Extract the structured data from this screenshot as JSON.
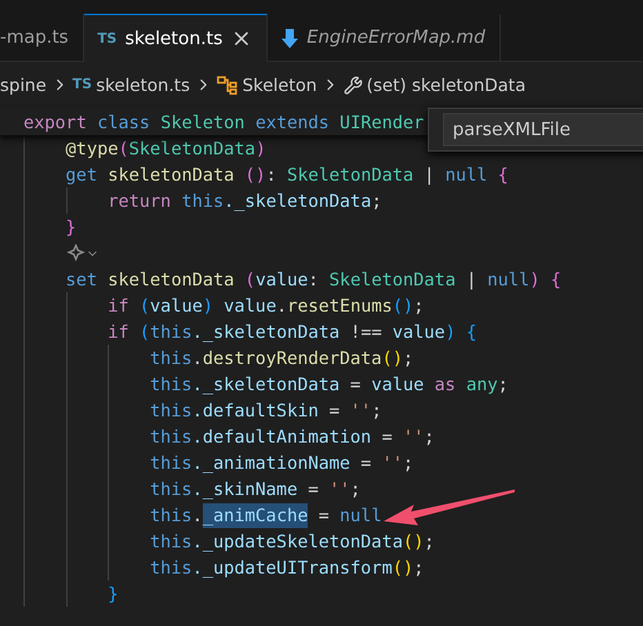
{
  "tabs": [
    {
      "label": "-map.ts",
      "kind": "plain",
      "selected": false
    },
    {
      "label": "skeleton.ts",
      "kind": "ts",
      "badge": "TS",
      "selected": true
    },
    {
      "label": "EngineErrorMap.md",
      "kind": "md",
      "selected": false
    }
  ],
  "breadcrumbs": [
    {
      "label": "spine",
      "kind": "plain"
    },
    {
      "label": "skeleton.ts",
      "kind": "ts",
      "badge": "TS"
    },
    {
      "label": "Skeleton",
      "kind": "class"
    },
    {
      "label": "(set) skeletonData",
      "kind": "property"
    }
  ],
  "quick_input": {
    "value": "parseXMLFile"
  },
  "code": {
    "kind": "code",
    "tokens": [
      {
        "t": "export",
        "kind": "kw"
      },
      {
        "t": " class",
        "kind": "st"
      },
      {
        "t": " Skeleton",
        "kind": "ty"
      },
      {
        "t": " extends",
        "kind": "st"
      },
      {
        "t": " UIRender",
        "kind": "ty"
      }
    ],
    "children": [
      {
        "kind": "code",
        "tokens": [
          {
            "t": "@type",
            "kind": "fn"
          },
          {
            "t": "(",
            "kind": "b2"
          },
          {
            "t": "SkeletonData",
            "kind": "ty"
          },
          {
            "t": ")",
            "kind": "b2"
          }
        ]
      },
      {
        "kind": "code",
        "tokens": [
          {
            "t": "get",
            "kind": "st"
          },
          {
            "t": " skeletonData ",
            "kind": "fn"
          },
          {
            "t": "()",
            "kind": "b2"
          },
          {
            "t": ": ",
            "kind": "pl"
          },
          {
            "t": "SkeletonData",
            "kind": "ty"
          },
          {
            "t": " | ",
            "kind": "pl"
          },
          {
            "t": "null",
            "kind": "st"
          },
          {
            "t": " {",
            "kind": "b2"
          }
        ],
        "children": [
          {
            "kind": "code",
            "tokens": [
              {
                "t": "return",
                "kind": "kw"
              },
              {
                "t": " this",
                "kind": "st"
              },
              {
                "t": "._skeletonData",
                "kind": "var"
              },
              {
                "t": ";",
                "kind": "pl"
              }
            ]
          }
        ]
      },
      {
        "kind": "code",
        "tokens": [
          {
            "t": "}",
            "kind": "b2"
          }
        ]
      },
      {
        "kind": "codelens"
      },
      {
        "kind": "code",
        "tokens": [
          {
            "t": "set",
            "kind": "st"
          },
          {
            "t": " skeletonData ",
            "kind": "fn"
          },
          {
            "t": "(",
            "kind": "b2"
          },
          {
            "t": "value",
            "kind": "var"
          },
          {
            "t": ": ",
            "kind": "pl"
          },
          {
            "t": "SkeletonData",
            "kind": "ty"
          },
          {
            "t": " | ",
            "kind": "pl"
          },
          {
            "t": "null",
            "kind": "st"
          },
          {
            "t": ")",
            "kind": "b2"
          },
          {
            "t": " {",
            "kind": "b2"
          }
        ],
        "children": [
          {
            "kind": "code",
            "tokens": [
              {
                "t": "if",
                "kind": "kw"
              },
              {
                "t": " (",
                "kind": "b3"
              },
              {
                "t": "value",
                "kind": "var"
              },
              {
                "t": ")",
                "kind": "b3"
              },
              {
                "t": " value",
                "kind": "var"
              },
              {
                "t": ".",
                "kind": "pl"
              },
              {
                "t": "resetEnums",
                "kind": "fn"
              },
              {
                "t": "()",
                "kind": "b3"
              },
              {
                "t": ";",
                "kind": "pl"
              }
            ]
          },
          {
            "kind": "code",
            "tokens": [
              {
                "t": "if",
                "kind": "kw"
              },
              {
                "t": " (",
                "kind": "b3"
              },
              {
                "t": "this",
                "kind": "st"
              },
              {
                "t": "._skeletonData",
                "kind": "var"
              },
              {
                "t": " !== ",
                "kind": "pl"
              },
              {
                "t": "value",
                "kind": "var"
              },
              {
                "t": ")",
                "kind": "b3"
              },
              {
                "t": " {",
                "kind": "b3"
              }
            ],
            "children": [
              {
                "kind": "code",
                "tokens": [
                  {
                    "t": "this",
                    "kind": "st"
                  },
                  {
                    "t": ".",
                    "kind": "pl"
                  },
                  {
                    "t": "destroyRenderData",
                    "kind": "fn"
                  },
                  {
                    "t": "()",
                    "kind": "b1"
                  },
                  {
                    "t": ";",
                    "kind": "pl"
                  }
                ]
              },
              {
                "kind": "code",
                "tokens": [
                  {
                    "t": "this",
                    "kind": "st"
                  },
                  {
                    "t": "._skeletonData",
                    "kind": "var"
                  },
                  {
                    "t": " = ",
                    "kind": "pl"
                  },
                  {
                    "t": "value",
                    "kind": "var"
                  },
                  {
                    "t": " as",
                    "kind": "kw"
                  },
                  {
                    "t": " any",
                    "kind": "ty"
                  },
                  {
                    "t": ";",
                    "kind": "pl"
                  }
                ]
              },
              {
                "kind": "code",
                "tokens": [
                  {
                    "t": "this",
                    "kind": "st"
                  },
                  {
                    "t": ".defaultSkin",
                    "kind": "var"
                  },
                  {
                    "t": " = ",
                    "kind": "pl"
                  },
                  {
                    "t": "''",
                    "kind": "str"
                  },
                  {
                    "t": ";",
                    "kind": "pl"
                  }
                ]
              },
              {
                "kind": "code",
                "tokens": [
                  {
                    "t": "this",
                    "kind": "st"
                  },
                  {
                    "t": ".defaultAnimation",
                    "kind": "var"
                  },
                  {
                    "t": " = ",
                    "kind": "pl"
                  },
                  {
                    "t": "''",
                    "kind": "str"
                  },
                  {
                    "t": ";",
                    "kind": "pl"
                  }
                ]
              },
              {
                "kind": "code",
                "tokens": [
                  {
                    "t": "this",
                    "kind": "st"
                  },
                  {
                    "t": "._animationName",
                    "kind": "var"
                  },
                  {
                    "t": " = ",
                    "kind": "pl"
                  },
                  {
                    "t": "''",
                    "kind": "str"
                  },
                  {
                    "t": ";",
                    "kind": "pl"
                  }
                ]
              },
              {
                "kind": "code",
                "tokens": [
                  {
                    "t": "this",
                    "kind": "st"
                  },
                  {
                    "t": "._skinName",
                    "kind": "var"
                  },
                  {
                    "t": " = ",
                    "kind": "pl"
                  },
                  {
                    "t": "''",
                    "kind": "str"
                  },
                  {
                    "t": ";",
                    "kind": "pl"
                  }
                ]
              },
              {
                "kind": "code",
                "tokens": [
                  {
                    "t": "this",
                    "kind": "st"
                  },
                  {
                    "t": ".",
                    "kind": "pl"
                  },
                  {
                    "t": "_animCache",
                    "kind": "sel"
                  },
                  {
                    "t": " = ",
                    "kind": "pl"
                  },
                  {
                    "t": "null",
                    "kind": "st"
                  }
                ]
              },
              {
                "kind": "code",
                "tokens": [
                  {
                    "t": "this",
                    "kind": "st"
                  },
                  {
                    "t": "._updateSkeletonData",
                    "kind": "var"
                  },
                  {
                    "t": "()",
                    "kind": "b1"
                  },
                  {
                    "t": ";",
                    "kind": "pl"
                  }
                ]
              },
              {
                "kind": "code",
                "tokens": [
                  {
                    "t": "this",
                    "kind": "st"
                  },
                  {
                    "t": "._updateUITransform",
                    "kind": "var"
                  },
                  {
                    "t": "()",
                    "kind": "b1"
                  },
                  {
                    "t": ";",
                    "kind": "pl"
                  }
                ]
              }
            ]
          },
          {
            "kind": "code",
            "tokens": [
              {
                "t": "}",
                "kind": "b3"
              }
            ]
          }
        ]
      }
    ]
  }
}
